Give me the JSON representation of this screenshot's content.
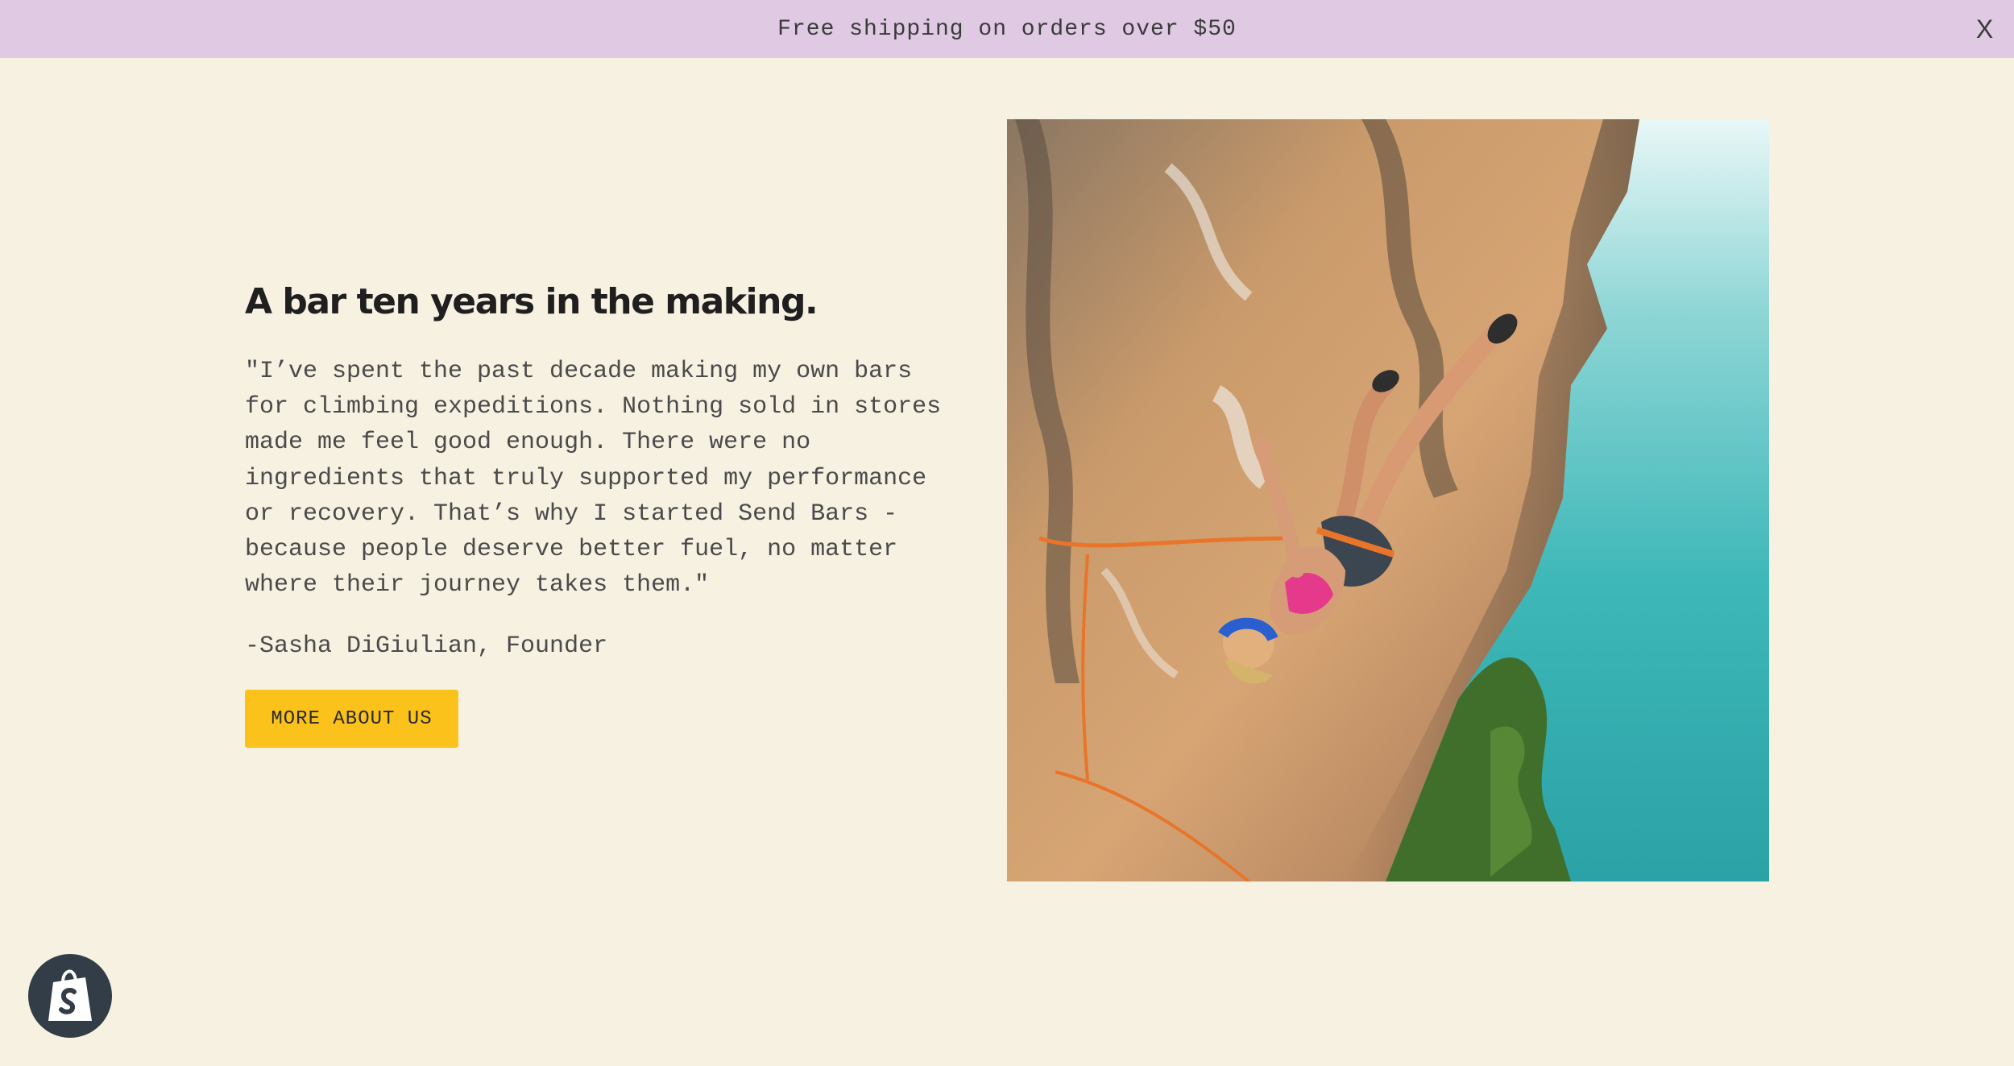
{
  "announcement": {
    "text": "Free shipping on orders over $50",
    "close_label": "X"
  },
  "story": {
    "heading": "A bar ten years in the making.",
    "quote": "\"I’ve spent the past decade making my own bars for climbing expeditions. Nothing sold in stores made me feel good enough. There were no ingredients that truly supported my performance or recovery. That’s why I started Send Bars - because people deserve better fuel, no matter where their journey takes them.\"",
    "author": "-Sasha DiGiulian, Founder",
    "button_label": "MORE ABOUT US"
  },
  "image": {
    "description": "climber-on-cliff-photo"
  },
  "shop_badge": {
    "icon": "shopify-bag-icon"
  },
  "colors": {
    "page_bg": "#f6f1e1",
    "announcement_bg": "#dfc9e3",
    "button_bg": "#fbc21c",
    "badge_bg": "#333d47"
  }
}
